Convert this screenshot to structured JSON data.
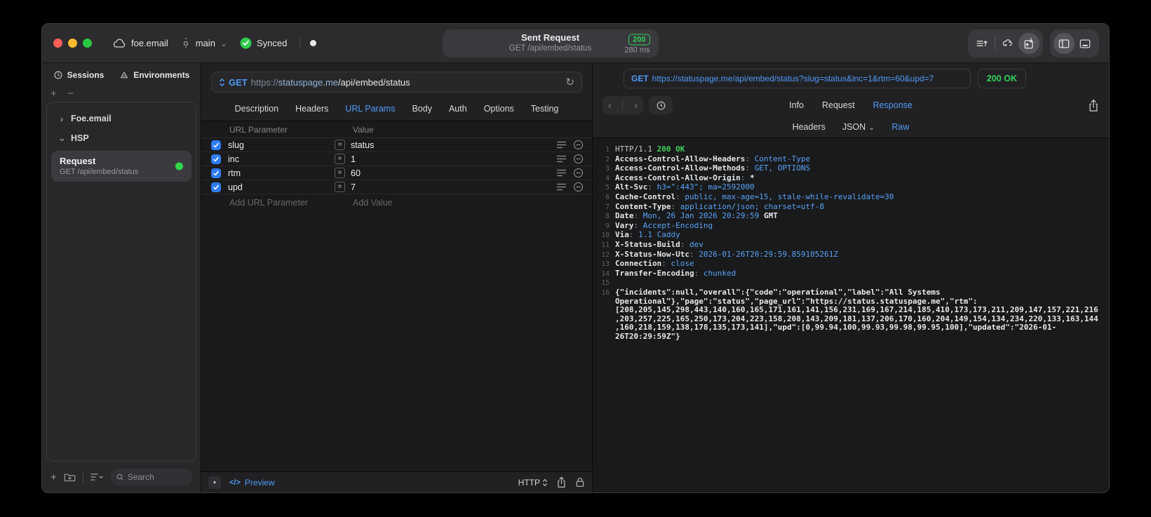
{
  "titlebar": {
    "project": "foe.email",
    "branch": "main",
    "sync_status": "Synced",
    "request_pill": {
      "title": "Sent Request",
      "subtitle": "GET /api/embed/status",
      "status_code": "200",
      "duration": "280 ms"
    }
  },
  "sidebar": {
    "tabs": [
      {
        "label": "Sessions"
      },
      {
        "label": "Environments"
      }
    ],
    "tree": [
      {
        "label": "Foe.email"
      },
      {
        "label": "HSP"
      }
    ],
    "request_item": {
      "title": "Request",
      "subtitle": "GET /api/embed/status"
    },
    "search_placeholder": "Search"
  },
  "request_pane": {
    "method": "GET",
    "url": {
      "scheme": "https://",
      "host": "statuspage.me",
      "path": "/api/embed/status"
    },
    "tabs": [
      "Description",
      "Headers",
      "URL Params",
      "Body",
      "Auth",
      "Options",
      "Testing"
    ],
    "active_tab": "URL Params",
    "params": {
      "col_param": "URL Parameter",
      "col_value": "Value",
      "rows": [
        {
          "name": "slug",
          "value": "status"
        },
        {
          "name": "inc",
          "value": "1"
        },
        {
          "name": "rtm",
          "value": "60"
        },
        {
          "name": "upd",
          "value": "7"
        }
      ],
      "add_name": "Add URL Parameter",
      "add_value": "Add Value"
    },
    "footer": {
      "code_glyph": "</>",
      "preview": "Preview",
      "protocol": "HTTP"
    }
  },
  "response_pane": {
    "request_line": {
      "method": "GET",
      "url": "https://statuspage.me/api/embed/status?slug=status&inc=1&rtm=60&upd=7"
    },
    "status": "200 OK",
    "tabs": [
      "Info",
      "Request",
      "Response"
    ],
    "active_tab": "Response",
    "view_tabs": [
      {
        "label": "Headers"
      },
      {
        "label": "JSON",
        "dropdown": true
      },
      {
        "label": "Raw"
      }
    ],
    "active_view_tab": "Raw",
    "http": {
      "protocol": "HTTP/1.1",
      "status": "200 OK",
      "separator": ": ",
      "headers": [
        {
          "name": "Access-Control-Allow-Headers",
          "value": "Content-Type"
        },
        {
          "name": "Access-Control-Allow-Methods",
          "value": "GET, OPTIONS"
        },
        {
          "name": "Access-Control-Allow-Origin",
          "value": "*",
          "plain": true
        },
        {
          "name": "Alt-Svc",
          "value": "h3=\":443\"; ma=2592000"
        },
        {
          "name": "Cache-Control",
          "value": "public, max-age=15, stale-while-revalidate=30"
        },
        {
          "name": "Content-Type",
          "value": "application/json; charset=utf-8"
        },
        {
          "name": "Date",
          "value": "Mon, 26 Jan 2026 20:29:59",
          "suffix": " GMT"
        },
        {
          "name": "Vary",
          "value": "Accept-Encoding"
        },
        {
          "name": "Via",
          "value": "1.1 Caddy"
        },
        {
          "name": "X-Status-Build",
          "value": "dev"
        },
        {
          "name": "X-Status-Now-Utc",
          "value": "2026-01-26T20:29:59.859105261Z"
        },
        {
          "name": "Connection",
          "value": "close"
        },
        {
          "name": "Transfer-Encoding",
          "value": "chunked"
        }
      ],
      "body": "{\"incidents\":null,\"overall\":{\"code\":\"operational\",\"label\":\"All Systems Operational\"},\"page\":\"status\",\"page_url\":\"https://status.statuspage.me\",\"rtm\":[208,205,145,298,443,140,160,165,171,161,141,156,231,169,167,214,185,410,173,173,211,209,147,157,221,216,203,257,225,165,250,173,204,223,158,208,143,209,181,137,206,170,160,204,149,154,134,234,220,133,163,144,160,218,159,138,178,135,173,141],\"upd\":[0,99.94,100,99.93,99.98,99.95,100],\"updated\":\"2026-01-26T20:29:59Z\"}"
    }
  },
  "icons": {
    "refresh": "↻",
    "chevron_down": "⌄",
    "chevron_right": "›",
    "back": "‹",
    "forward": "›",
    "plus": "+",
    "minus": "−",
    "equals": "=",
    "triangle": "▲"
  },
  "colors": {
    "accent_blue": "#4e9bf8",
    "green": "#30d158",
    "checkbox_blue": "#2f7cf7"
  }
}
